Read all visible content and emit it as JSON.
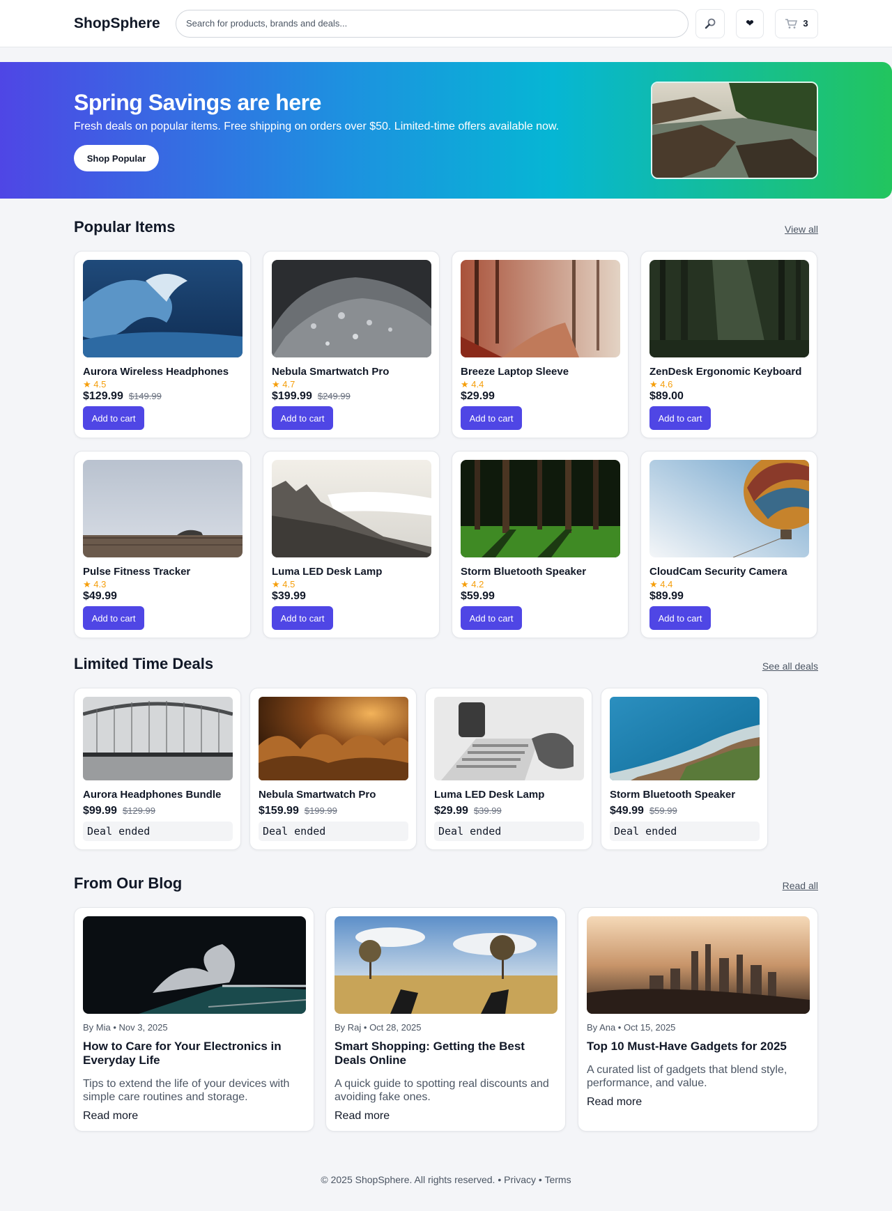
{
  "header": {
    "logo": "ShopSphere",
    "search_placeholder": "Search for products, brands and deals...",
    "search_icon": "search-icon",
    "wishlist_icon": "heart-icon",
    "cart_icon": "cart-icon",
    "cart_count": "3"
  },
  "hero": {
    "title": "Spring Savings are here",
    "subtitle": "Fresh deals on popular items. Free shipping on orders over $50. Limited-time offers available now.",
    "cta": "Shop Popular"
  },
  "popular": {
    "title": "Popular Items",
    "link": "View all",
    "add_label": "Add to cart",
    "items": [
      {
        "name": "Aurora Wireless Headphones",
        "rating": "★ 4.5",
        "price": "$129.99",
        "old_price": "$149.99"
      },
      {
        "name": "Nebula Smartwatch Pro",
        "rating": "★ 4.7",
        "price": "$199.99",
        "old_price": "$249.99"
      },
      {
        "name": "Breeze Laptop Sleeve",
        "rating": "★ 4.4",
        "price": "$29.99",
        "old_price": ""
      },
      {
        "name": "ZenDesk Ergonomic Keyboard",
        "rating": "★ 4.6",
        "price": "$89.00",
        "old_price": ""
      },
      {
        "name": "Pulse Fitness Tracker",
        "rating": "★ 4.3",
        "price": "$49.99",
        "old_price": ""
      },
      {
        "name": "Luma LED Desk Lamp",
        "rating": "★ 4.5",
        "price": "$39.99",
        "old_price": ""
      },
      {
        "name": "Storm Bluetooth Speaker",
        "rating": "★ 4.2",
        "price": "$59.99",
        "old_price": ""
      },
      {
        "name": "CloudCam Security Camera",
        "rating": "★ 4.4",
        "price": "$89.99",
        "old_price": ""
      }
    ]
  },
  "deals": {
    "title": "Limited Time Deals",
    "link": "See all deals",
    "items": [
      {
        "name": "Aurora Headphones Bundle",
        "price": "$99.99",
        "old_price": "$129.99",
        "status": "Deal ended"
      },
      {
        "name": "Nebula Smartwatch Pro",
        "price": "$159.99",
        "old_price": "$199.99",
        "status": "Deal ended"
      },
      {
        "name": "Luma LED Desk Lamp",
        "price": "$29.99",
        "old_price": "$39.99",
        "status": "Deal ended"
      },
      {
        "name": "Storm Bluetooth Speaker",
        "price": "$49.99",
        "old_price": "$59.99",
        "status": "Deal ended"
      }
    ]
  },
  "blog": {
    "title": "From Our Blog",
    "link": "Read all",
    "read_more": "Read more",
    "posts": [
      {
        "meta": "By Mia • Nov 3, 2025",
        "title": "How to Care for Your Electronics in Everyday Life",
        "excerpt": "Tips to extend the life of your devices with simple care routines and storage."
      },
      {
        "meta": "By Raj • Oct 28, 2025",
        "title": "Smart Shopping: Getting the Best Deals Online",
        "excerpt": "A quick guide to spotting real discounts and avoiding fake ones."
      },
      {
        "meta": "By Ana • Oct 15, 2025",
        "title": "Top 10 Must-Have Gadgets for 2025",
        "excerpt": "A curated list of gadgets that blend style, performance, and value."
      }
    ]
  },
  "footer": {
    "copyright": "© 2025 ShopSphere. All rights reserved.",
    "sep": "•",
    "privacy": "Privacy",
    "terms": "Terms"
  },
  "colors": {
    "accent": "#4f46e5",
    "star": "#f59e0b",
    "hero_gradient": [
      "#4f46e5",
      "#06b6d4",
      "#22c55e"
    ]
  }
}
